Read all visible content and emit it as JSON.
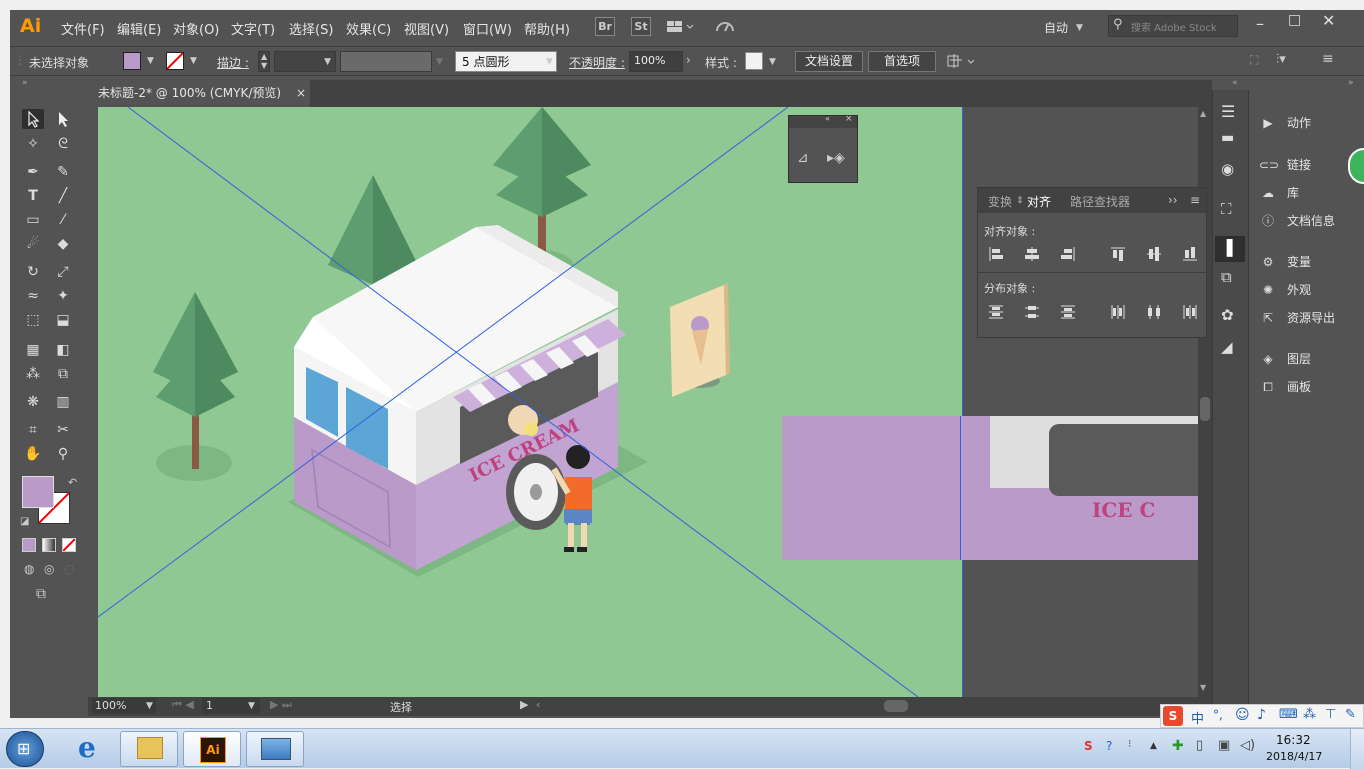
{
  "app": {
    "logo": "Ai",
    "brand_color": "#ff9a00"
  },
  "menu": [
    "文件(F)",
    "编辑(E)",
    "对象(O)",
    "文字(T)",
    "选择(S)",
    "效果(C)",
    "视图(V)",
    "窗口(W)",
    "帮助(H)"
  ],
  "bridge_buttons": [
    "Br",
    "St"
  ],
  "workspace": "自动",
  "search": {
    "placeholder": "搜索 Adobe Stock"
  },
  "control": {
    "no_selection": "未选择对象",
    "fill_color": "#b99ac9",
    "stroke_label": "描边 :",
    "brush_value": "5 点圆形",
    "opacity_label": "不透明度 :",
    "opacity_value": "100%",
    "style_label": "样式 :",
    "doc_settings": "文档设置",
    "preferences": "首选项"
  },
  "document": {
    "tab": "未标题-2* @ 100% (CMYK/预览)",
    "close": "×"
  },
  "status": {
    "zoom": "100%",
    "page": "1",
    "tool": "选择"
  },
  "align_panel": {
    "tabs": [
      "变换",
      "对齐",
      "路径查找器"
    ],
    "active_tab": "对齐",
    "align_objects": "对齐对象 :",
    "distribute_objects": "分布对象 :"
  },
  "right_panel": [
    "动作",
    "链接",
    "库",
    "文档信息",
    "变量",
    "外观",
    "资源导出",
    "图层",
    "画板"
  ],
  "artwork": {
    "truck_text": "ICE CREAM",
    "zoomed_text": "ICE C"
  },
  "taskbar": {
    "time": "16:32",
    "date": "2018/4/17",
    "ime": "中"
  },
  "colors": {
    "artboard": "#8fc892",
    "truck_purple": "#b99ac9",
    "truck_white": "#f2f2f2",
    "tree": "#5a9a6c",
    "text_pink": "#c0417f"
  }
}
